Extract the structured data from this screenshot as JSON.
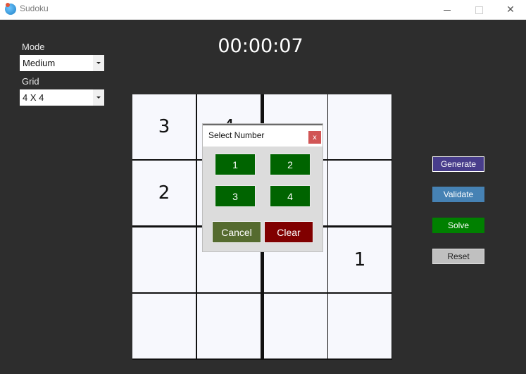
{
  "window": {
    "title": "Sudoku",
    "controls": [
      "minimize",
      "maximize",
      "close"
    ]
  },
  "controls": {
    "mode_label": "Mode",
    "mode_value": "Medium",
    "grid_label": "Grid",
    "grid_value": "4 X 4"
  },
  "timer": "00:00:07",
  "board": {
    "size": 4,
    "cells": [
      [
        "3",
        "4",
        "",
        ""
      ],
      [
        "2",
        "",
        "",
        ""
      ],
      [
        "",
        "",
        "",
        "1"
      ],
      [
        "",
        "",
        "",
        ""
      ]
    ]
  },
  "dialog": {
    "title": "Select Number",
    "close_label": "x",
    "numbers": [
      "1",
      "2",
      "3",
      "4"
    ],
    "cancel_label": "Cancel",
    "clear_label": "Clear"
  },
  "actions": {
    "generate": "Generate",
    "validate": "Validate",
    "solve": "Solve",
    "reset": "Reset"
  },
  "colors": {
    "background": "#2d2d2d",
    "cell": "#f7f8fd",
    "number_button": "#006400",
    "cancel": "#556b2f",
    "clear": "#800000",
    "generate": "#483d8b",
    "validate": "#4682b4",
    "solve": "#008000",
    "reset": "#c0c0c0",
    "dialog_close": "#d15555"
  }
}
